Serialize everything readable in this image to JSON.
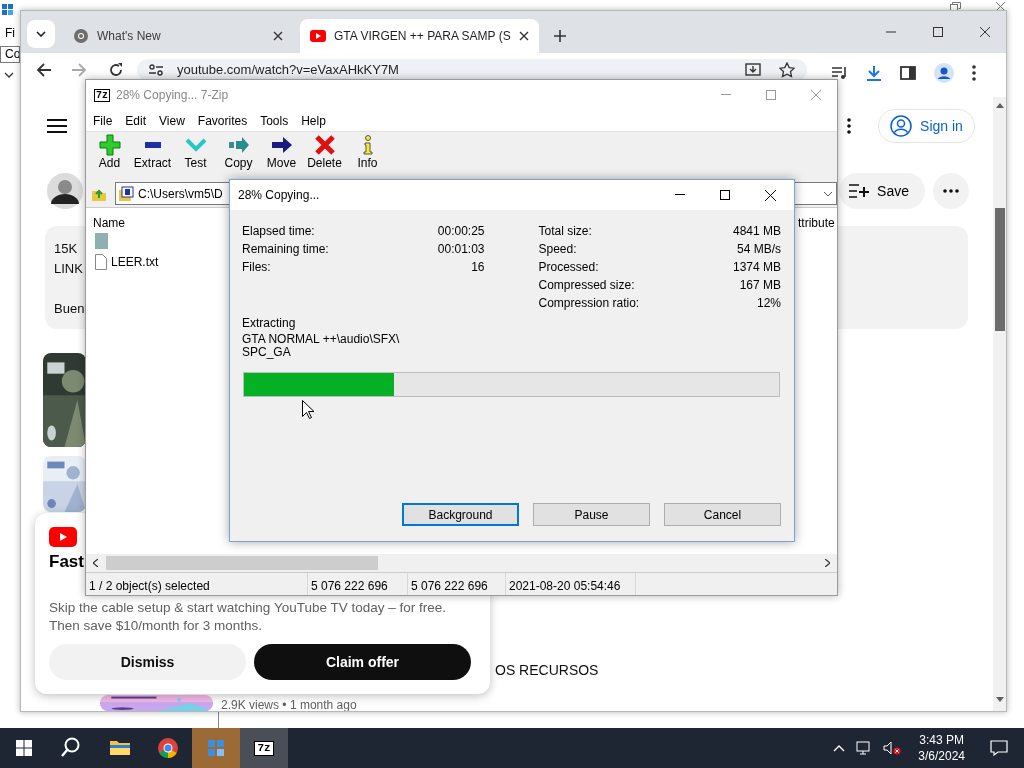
{
  "background_window": {
    "menu_fragment": "Fi",
    "field_fragment": "Co"
  },
  "browser": {
    "tabs": [
      {
        "title": "What's New",
        "kind": "chrome",
        "selected": false
      },
      {
        "title": "GTA VIRGEN ++ PARA SAMP (S",
        "kind": "youtube",
        "selected": true
      }
    ],
    "url": "youtube.com/watch?v=eVaxAHkKY7M"
  },
  "youtube": {
    "sign_in": "Sign in",
    "save": "Save",
    "description_lines": [
      "15K",
      "LINK",
      "Buen"
    ],
    "side_text": "OS RECURSOS",
    "video_meta": "2.9K views • 1 month ago"
  },
  "promo": {
    "title": "Fast",
    "text_lines": [
      "Skip the cable setup & start watching YouTube TV today – for free.",
      "Then save $10/month for 3 months."
    ],
    "buttons": [
      {
        "label": "Dismiss",
        "kind": "secondary"
      },
      {
        "label": "Claim offer",
        "kind": "primary"
      }
    ]
  },
  "sevenzip": {
    "logo": "7z",
    "title": "28% Copying... 7-Zip",
    "menu": [
      "File",
      "Edit",
      "View",
      "Favorites",
      "Tools",
      "Help"
    ],
    "toolbar": [
      {
        "label": "Add",
        "kind": "add"
      },
      {
        "label": "Extract",
        "kind": "extract"
      },
      {
        "label": "Test",
        "kind": "test"
      },
      {
        "label": "Copy",
        "kind": "copy"
      },
      {
        "label": "Move",
        "kind": "move"
      },
      {
        "label": "Delete",
        "kind": "delete"
      },
      {
        "label": "Info",
        "kind": "info"
      }
    ],
    "path": "C:\\Users\\vm5\\D",
    "columns": [
      "Name",
      "ttribute"
    ],
    "files": [
      {
        "kind": "folder"
      },
      {
        "kind": "file",
        "name": "LEER.txt"
      }
    ],
    "status": [
      "1 / 2 object(s) selected",
      "5 076 222 696",
      "5 076 222 696",
      "2021-08-20 05:54:46"
    ]
  },
  "dialog": {
    "title": "28% Copying...",
    "left_stats": [
      {
        "label": "Elapsed time:",
        "value": "00:00:25"
      },
      {
        "label": "Remaining time:",
        "value": "00:01:03"
      },
      {
        "label": "Files:",
        "value": "16"
      }
    ],
    "right_stats": [
      {
        "label": "Total size:",
        "value": "4841 MB"
      },
      {
        "label": "Speed:",
        "value": "54 MB/s"
      },
      {
        "label": "Processed:",
        "value": "1374 MB"
      },
      {
        "label": "Compressed size:",
        "value": "167 MB"
      },
      {
        "label": "Compression ratio:",
        "value": "12%"
      }
    ],
    "action": "Extracting",
    "file_lines": [
      "GTA NORMAL ++\\audio\\SFX\\",
      "SPC_GA"
    ],
    "level": 0.28,
    "buttons": [
      {
        "label": "Background",
        "focused": true
      },
      {
        "label": "Pause",
        "focused": false
      },
      {
        "label": "Cancel",
        "focused": false
      }
    ]
  },
  "taskbar": {
    "apps": [
      {
        "kind": "search"
      },
      {
        "kind": "explorer"
      },
      {
        "kind": "chrome"
      },
      {
        "kind": "tool"
      },
      {
        "kind": "sevenzip",
        "label": "7z"
      }
    ],
    "time": "3:43 PM",
    "date": "3/6/2024"
  }
}
